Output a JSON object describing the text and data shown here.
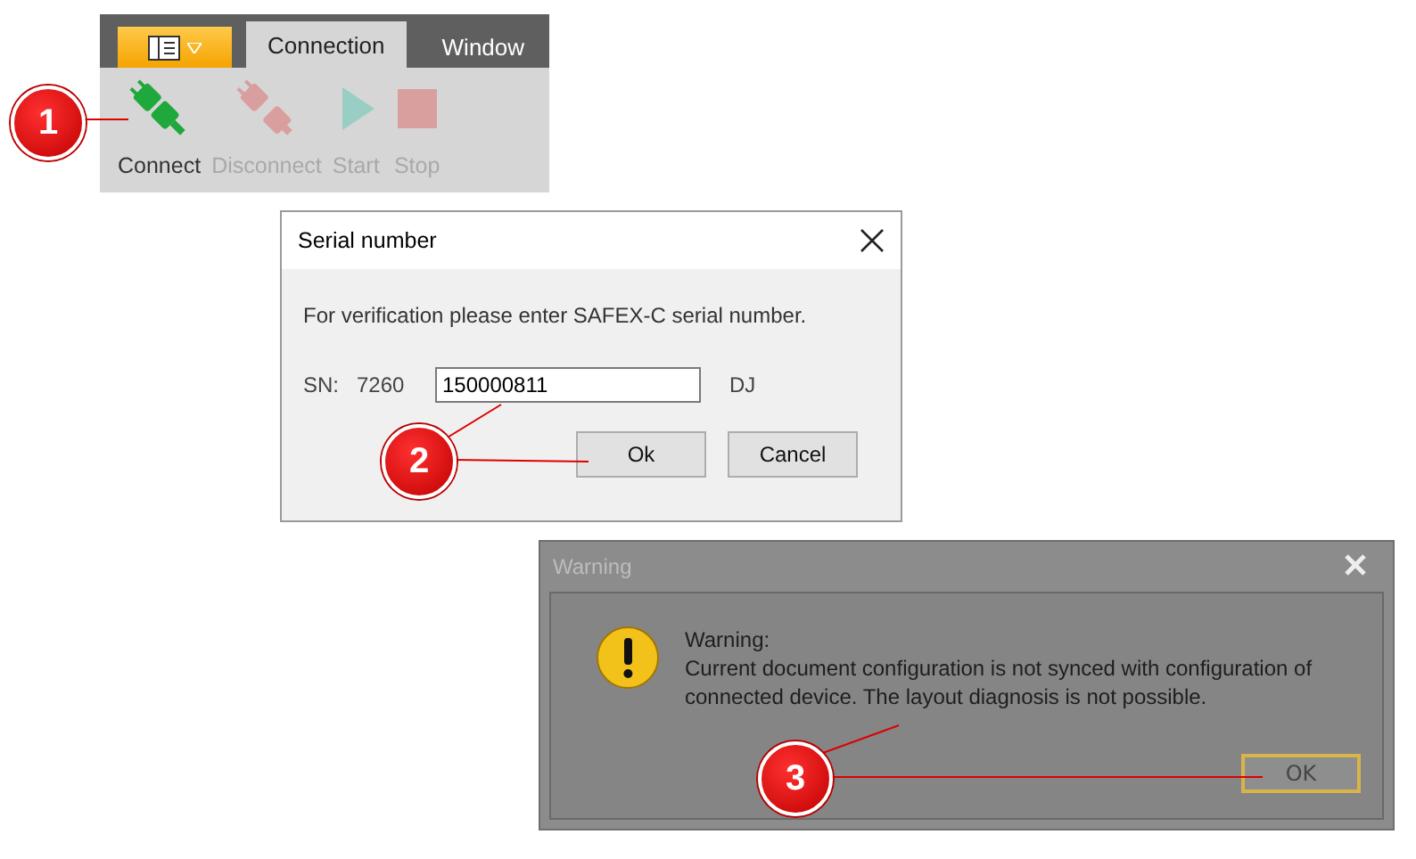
{
  "ribbon": {
    "tabs": [
      {
        "label": "Connection",
        "selected": true
      },
      {
        "label": "Window",
        "selected": false
      }
    ],
    "buttons": [
      {
        "kind": "connect",
        "label": "Connect",
        "disabled": false
      },
      {
        "kind": "disconnect",
        "label": "Disconnect",
        "disabled": true
      },
      {
        "kind": "start",
        "label": "Start",
        "disabled": true
      },
      {
        "kind": "stop",
        "label": "Stop",
        "disabled": true
      }
    ]
  },
  "serial_dialog": {
    "title": "Serial number",
    "prompt": "For verification please enter SAFEX-C serial number.",
    "sn_label": "SN:",
    "sn_prefix": "7260",
    "value": "150000811",
    "suffix": "DJ",
    "buttons": [
      "Ok",
      "Cancel"
    ]
  },
  "warning_dialog": {
    "title": "Warning",
    "heading": "Warning:",
    "message": "Current document configuration is not synced with configuration of connected device. The layout diagnosis is not possible.",
    "buttons": [
      "OK"
    ]
  },
  "callouts": [
    {
      "number": "1"
    },
    {
      "number": "2"
    },
    {
      "number": "3"
    }
  ]
}
